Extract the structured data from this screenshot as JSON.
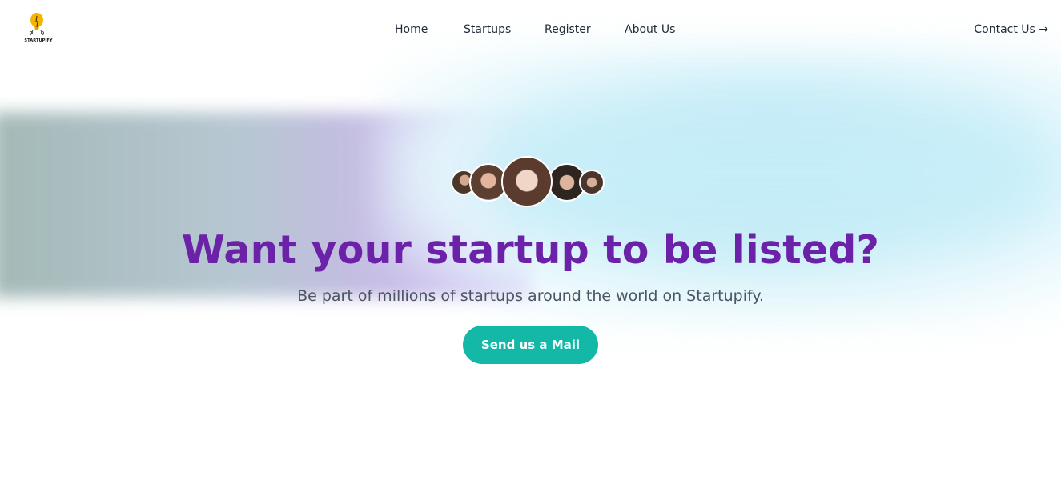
{
  "brand": {
    "name": "STARTUPIFY",
    "logo_icon": "lightbulb-icon",
    "accent_yellow": "#f5b400"
  },
  "nav": {
    "items": [
      {
        "label": "Home"
      },
      {
        "label": "Startups"
      },
      {
        "label": "Register"
      },
      {
        "label": "About Us"
      }
    ],
    "contact_label": "Contact Us →"
  },
  "hero": {
    "avatars": [
      "avatar-1",
      "avatar-2",
      "avatar-3",
      "avatar-4",
      "avatar-5"
    ],
    "headline": "Want your startup to be listed?",
    "subtext": "Be part of millions of startups around the world on Startupify.",
    "cta_label": "Send us a Mail"
  },
  "colors": {
    "headline": "#6b21a8",
    "cta": "#14b8a6",
    "text": "#1f2937",
    "subtext": "#4b5563"
  }
}
